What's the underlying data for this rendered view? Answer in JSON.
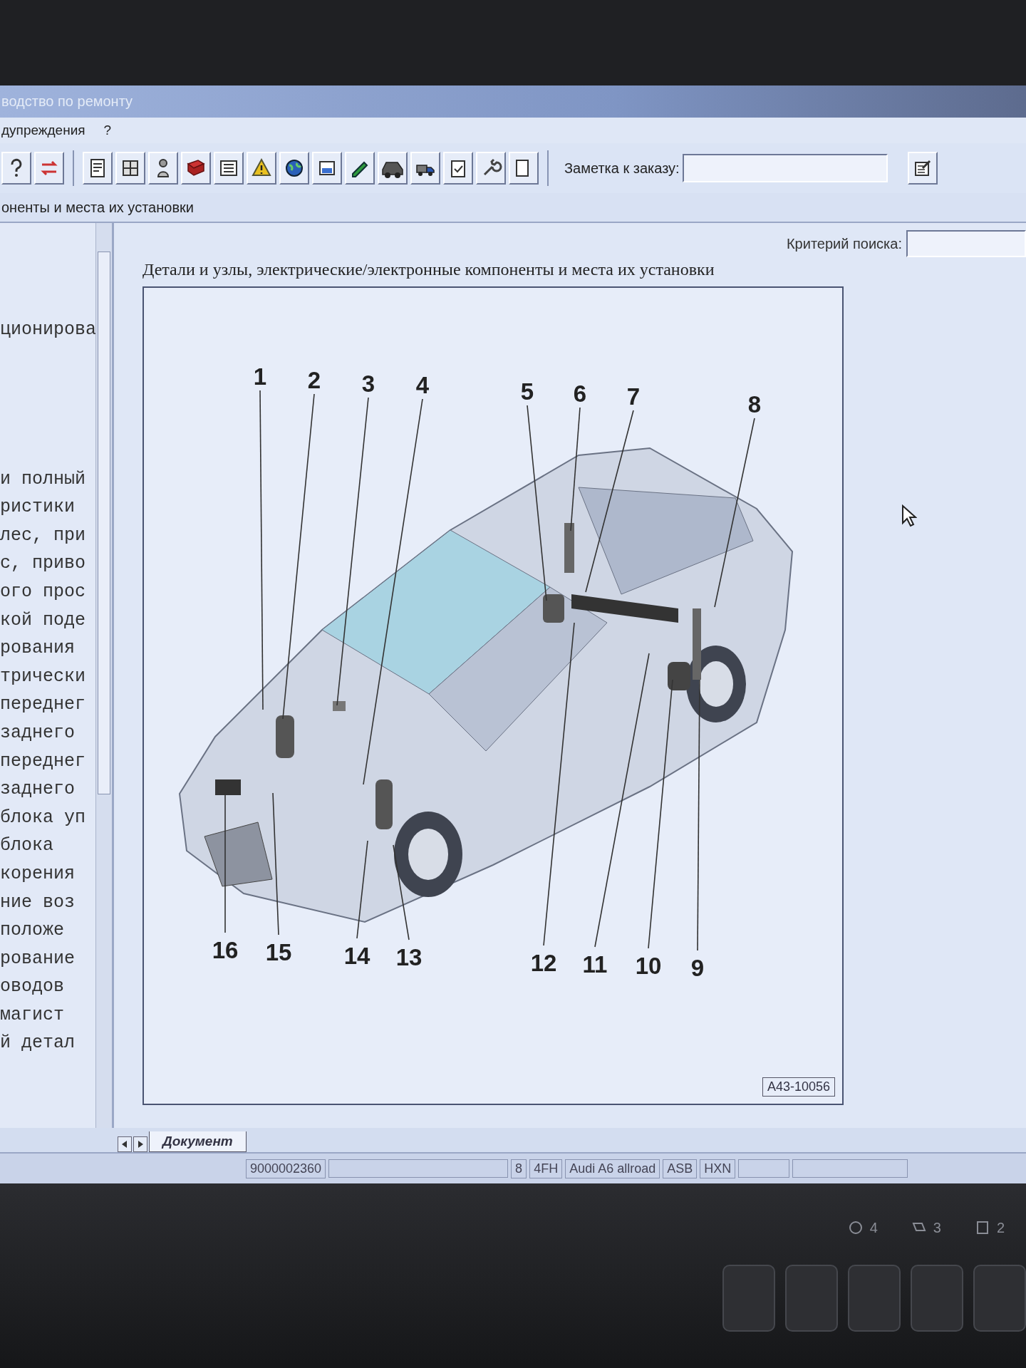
{
  "window": {
    "title": "водство по ремонту"
  },
  "menu": [
    {
      "label": "дупреждения"
    },
    {
      "label": "?"
    }
  ],
  "toolbar": {
    "note_label": "Заметка к заказу:"
  },
  "breadcrumb": "оненты и места их установки",
  "left_panel": {
    "paragraphs": [
      [
        "ционирова"
      ],
      [
        "и полный",
        "ристики",
        "лес, при",
        "с, приво",
        "ого прос",
        "кой поде",
        "рования",
        "трически",
        "переднег",
        "заднего",
        "переднег",
        "заднего",
        "блока уп",
        "блока",
        "корения",
        "ние воз",
        "положе",
        "рование",
        "оводов",
        "магист",
        "й детал"
      ]
    ]
  },
  "search": {
    "label": "Критерий поиска:"
  },
  "document": {
    "heading": "Детали и узлы, электрические/электронные компоненты и места их установки",
    "callouts": [
      "1",
      "2",
      "3",
      "4",
      "5",
      "6",
      "7",
      "8",
      "16",
      "15",
      "14",
      "13",
      "12",
      "11",
      "10",
      "9"
    ],
    "figure_id": "A43-10056"
  },
  "tabs": [
    {
      "label": "Документ",
      "selected": true
    }
  ],
  "status_bar": [
    "9000002360",
    "8",
    "4FH",
    "Audi A6 allroad",
    "ASB",
    "HXN"
  ],
  "bezel_indicators": [
    "4",
    "3",
    "2"
  ]
}
